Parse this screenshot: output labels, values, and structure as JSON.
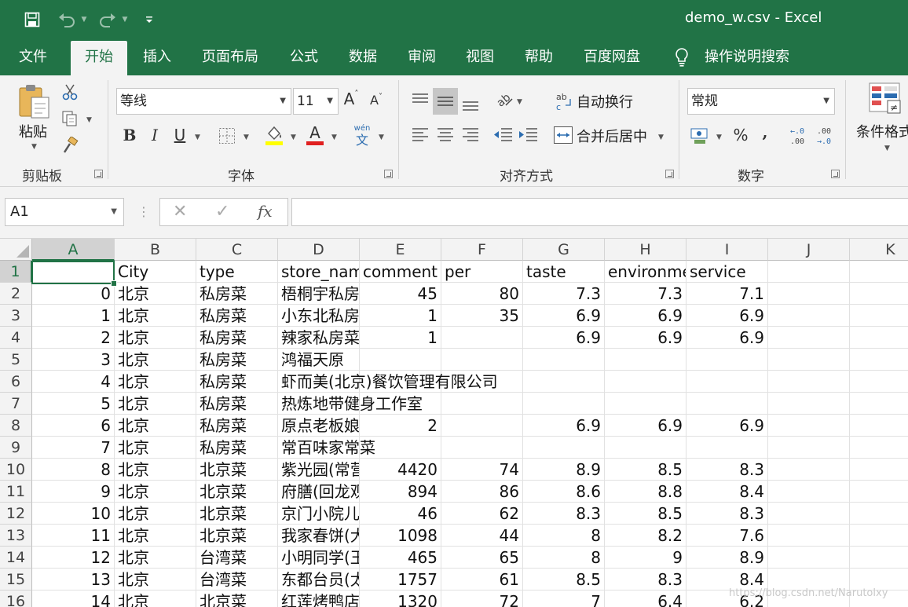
{
  "window": {
    "title": "demo_w.csv  -  Excel",
    "accent_color": "#217346"
  },
  "quick_access": {
    "save_icon": "save-icon",
    "undo_icon": "undo-icon",
    "redo_icon": "redo-icon",
    "customize_icon": "customize-quick-access-icon"
  },
  "menu": {
    "tabs": [
      {
        "label": "文件"
      },
      {
        "label": "开始",
        "active": true
      },
      {
        "label": "插入"
      },
      {
        "label": "页面布局"
      },
      {
        "label": "公式"
      },
      {
        "label": "数据"
      },
      {
        "label": "审阅"
      },
      {
        "label": "视图"
      },
      {
        "label": "帮助"
      },
      {
        "label": "百度网盘"
      }
    ],
    "tell_me": "操作说明搜索"
  },
  "ribbon": {
    "clipboard": {
      "paste_label": "粘贴",
      "group_label": "剪贴板"
    },
    "font": {
      "font_name": "等线",
      "font_size": "11",
      "group_label": "字体",
      "wen_label": "wén",
      "wen_char": "文"
    },
    "alignment": {
      "wrap_text": "自动换行",
      "merge_center": "合并后居中",
      "group_label": "对齐方式"
    },
    "number": {
      "format": "常规",
      "group_label": "数字"
    },
    "styles": {
      "conditional_format": "条件格式"
    }
  },
  "formula_bar": {
    "name_box": "A1",
    "formula": ""
  },
  "sheet": {
    "columns": [
      "A",
      "B",
      "C",
      "D",
      "E",
      "F",
      "G",
      "H",
      "I",
      "J",
      "K"
    ],
    "selected_cell": "A1",
    "rows": [
      {
        "n": "1",
        "A": "",
        "B": "City",
        "C": "type",
        "D": "store_name",
        "E": "comment",
        "F": "per",
        "G": "taste",
        "H": "environment",
        "I": "service"
      },
      {
        "n": "2",
        "A": "0",
        "B": "北京",
        "C": "私房菜",
        "D": "梧桐宇私房菜",
        "E": "45",
        "F": "80",
        "G": "7.3",
        "H": "7.3",
        "I": "7.1"
      },
      {
        "n": "3",
        "A": "1",
        "B": "北京",
        "C": "私房菜",
        "D": "小东北私房菜",
        "E": "1",
        "F": "35",
        "G": "6.9",
        "H": "6.9",
        "I": "6.9"
      },
      {
        "n": "4",
        "A": "2",
        "B": "北京",
        "C": "私房菜",
        "D": "辣家私房菜",
        "E": "1",
        "F": "",
        "G": "6.9",
        "H": "6.9",
        "I": "6.9"
      },
      {
        "n": "5",
        "A": "3",
        "B": "北京",
        "C": "私房菜",
        "D": "鸿福天原",
        "E": "",
        "F": "",
        "G": "",
        "H": "",
        "I": ""
      },
      {
        "n": "6",
        "A": "4",
        "B": "北京",
        "C": "私房菜",
        "D": "虾而美(北京)餐饮管理有限公司",
        "E": "",
        "F": "",
        "G": "",
        "H": "",
        "I": ""
      },
      {
        "n": "7",
        "A": "5",
        "B": "北京",
        "C": "私房菜",
        "D": "热炼地带健身工作室",
        "E": "",
        "F": "",
        "G": "",
        "H": "",
        "I": ""
      },
      {
        "n": "8",
        "A": "6",
        "B": "北京",
        "C": "私房菜",
        "D": "原点老板娘",
        "E": "2",
        "F": "",
        "G": "6.9",
        "H": "6.9",
        "I": "6.9"
      },
      {
        "n": "9",
        "A": "7",
        "B": "北京",
        "C": "私房菜",
        "D": "常百味家常菜",
        "E": "",
        "F": "",
        "G": "",
        "H": "",
        "I": ""
      },
      {
        "n": "10",
        "A": "8",
        "B": "北京",
        "C": "北京菜",
        "D": "紫光园(常营)",
        "E": "4420",
        "F": "74",
        "G": "8.9",
        "H": "8.5",
        "I": "8.3"
      },
      {
        "n": "11",
        "A": "9",
        "B": "北京",
        "C": "北京菜",
        "D": "府膳(回龙观)",
        "E": "894",
        "F": "86",
        "G": "8.6",
        "H": "8.8",
        "I": "8.4"
      },
      {
        "n": "12",
        "A": "10",
        "B": "北京",
        "C": "北京菜",
        "D": "京门小院儿",
        "E": "46",
        "F": "62",
        "G": "8.3",
        "H": "8.5",
        "I": "8.3"
      },
      {
        "n": "13",
        "A": "11",
        "B": "北京",
        "C": "北京菜",
        "D": "我家春饼(大悦城)",
        "E": "1098",
        "F": "44",
        "G": "8",
        "H": "8.2",
        "I": "7.6"
      },
      {
        "n": "14",
        "A": "12",
        "B": "北京",
        "C": "台湾菜",
        "D": "小明同学(王府井)",
        "E": "465",
        "F": "65",
        "G": "8",
        "H": "9",
        "I": "8.9"
      },
      {
        "n": "15",
        "A": "13",
        "B": "北京",
        "C": "台湾菜",
        "D": "东都台员(太古里)",
        "E": "1757",
        "F": "61",
        "G": "8.5",
        "H": "8.3",
        "I": "8.4"
      },
      {
        "n": "16",
        "A": "14",
        "B": "北京",
        "C": "北京菜",
        "D": "红莲烤鸭店",
        "E": "1320",
        "F": "72",
        "G": "7",
        "H": "6.4",
        "I": "6.2"
      }
    ]
  },
  "watermark": "https://blog.csdn.net/Narutolxy"
}
